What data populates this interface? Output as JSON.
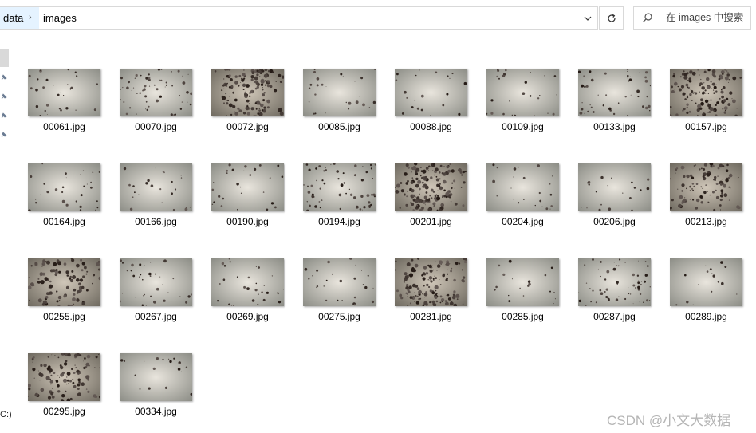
{
  "address_bar": {
    "crumbs": [
      "data",
      "images"
    ],
    "separator": "›"
  },
  "search": {
    "placeholder": "在 images 中搜索"
  },
  "nav": {
    "drive_label": "C:)"
  },
  "files": [
    {
      "name": "00061.jpg",
      "density": 0.12,
      "dark": false
    },
    {
      "name": "00070.jpg",
      "density": 0.3,
      "dark": false
    },
    {
      "name": "00072.jpg",
      "density": 0.85,
      "dark": true
    },
    {
      "name": "00085.jpg",
      "density": 0.1,
      "dark": false
    },
    {
      "name": "00088.jpg",
      "density": 0.08,
      "dark": false
    },
    {
      "name": "00109.jpg",
      "density": 0.1,
      "dark": false
    },
    {
      "name": "00133.jpg",
      "density": 0.22,
      "dark": false
    },
    {
      "name": "00157.jpg",
      "density": 0.8,
      "dark": true
    },
    {
      "name": "00164.jpg",
      "density": 0.12,
      "dark": false
    },
    {
      "name": "00166.jpg",
      "density": 0.08,
      "dark": false
    },
    {
      "name": "00190.jpg",
      "density": 0.1,
      "dark": false
    },
    {
      "name": "00194.jpg",
      "density": 0.3,
      "dark": false
    },
    {
      "name": "00201.jpg",
      "density": 0.9,
      "dark": true
    },
    {
      "name": "00204.jpg",
      "density": 0.08,
      "dark": false
    },
    {
      "name": "00206.jpg",
      "density": 0.06,
      "dark": false
    },
    {
      "name": "00213.jpg",
      "density": 0.55,
      "dark": true
    },
    {
      "name": "00255.jpg",
      "density": 0.55,
      "dark": true
    },
    {
      "name": "00267.jpg",
      "density": 0.15,
      "dark": false
    },
    {
      "name": "00269.jpg",
      "density": 0.12,
      "dark": false
    },
    {
      "name": "00275.jpg",
      "density": 0.1,
      "dark": false
    },
    {
      "name": "00281.jpg",
      "density": 0.85,
      "dark": true
    },
    {
      "name": "00285.jpg",
      "density": 0.06,
      "dark": false
    },
    {
      "name": "00287.jpg",
      "density": 0.3,
      "dark": false
    },
    {
      "name": "00289.jpg",
      "density": 0.04,
      "dark": false
    },
    {
      "name": "00295.jpg",
      "density": 0.6,
      "dark": true
    },
    {
      "name": "00334.jpg",
      "density": 0.05,
      "dark": false
    }
  ],
  "watermark": "CSDN @小文大数据"
}
